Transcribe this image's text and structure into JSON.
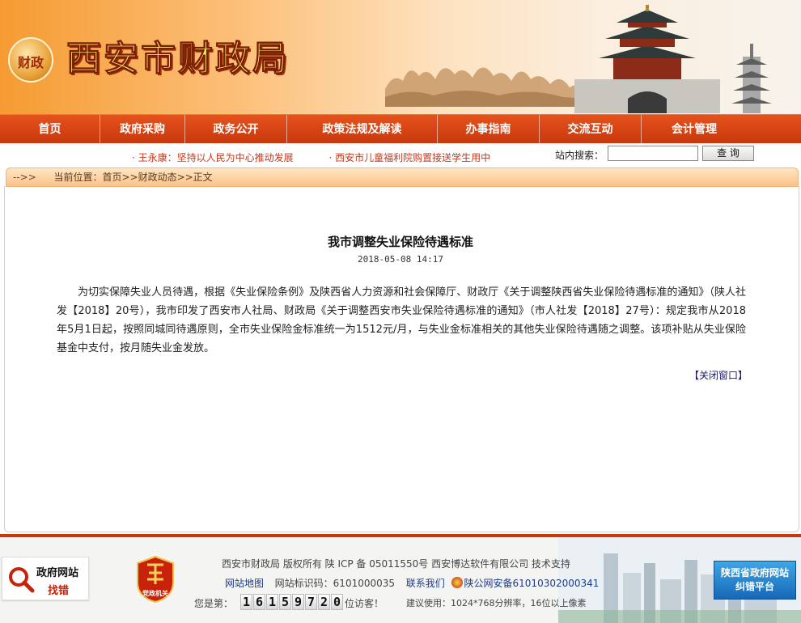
{
  "header": {
    "site_title": "西安市财政局",
    "logo_text": "财政"
  },
  "nav": {
    "items": [
      {
        "label": "首页"
      },
      {
        "label": "政府采购"
      },
      {
        "label": "政务公开"
      },
      {
        "label": "政策法规及解读"
      },
      {
        "label": "办事指南"
      },
      {
        "label": "交流互动"
      },
      {
        "label": "会计管理"
      }
    ]
  },
  "ticker": {
    "items": [
      "· 王永康：坚持以人民为中心推动发展",
      "· 西安市儿童福利院购置接送学生用中"
    ]
  },
  "search": {
    "label": "站内搜索：",
    "value": "",
    "button": "查 询"
  },
  "breadcrumb": {
    "arrow": "-->>",
    "prefix": "当前位置：",
    "path": "首页>>财政动态>>正文"
  },
  "article": {
    "title": "我市调整失业保险待遇标准",
    "date": "2018-05-08 14:17",
    "body": "为切实保障失业人员待遇，根据《失业保险条例》及陕西省人力资源和社会保障厅、财政厅《关于调整陕西省失业保险待遇标准的通知》（陕人社发【2018】20号），我市印发了西安市人社局、财政局《关于调整西安市失业保险待遇标准的通知》（市人社发【2018】27号）：规定我市从2018年5月1日起，按照同城同待遇原则，全市失业保险金标准统一为1512元/月，与失业金标准相关的其他失业保险待遇随之调整。该项补贴从失业保险基金中支付，按月随失业金发放。",
    "close": "【关闭窗口】"
  },
  "footer": {
    "copyright": "西安市财政局  版权所有  陕 ICP 备 05011550号   西安博达软件有限公司   技术支持",
    "sitemap": "网站地图",
    "site_id": "网站标识码：6101000035",
    "contact": "联系我们",
    "police": "陕公网安备61010302000341",
    "visitor_prefix": "您是第：",
    "visitor_digits": [
      "1",
      "6",
      "1",
      "5",
      "9",
      "7",
      "2",
      "0"
    ],
    "visitor_suffix": "位访客！",
    "resolution": "建议使用：1024*768分辨率，16位以上像素",
    "error_badge_line1": "政府网站",
    "error_badge_line2": "找错",
    "party_badge": "党政机关",
    "provincial_line1": "陕西省政府网站",
    "provincial_line2": "纠错平台"
  }
}
